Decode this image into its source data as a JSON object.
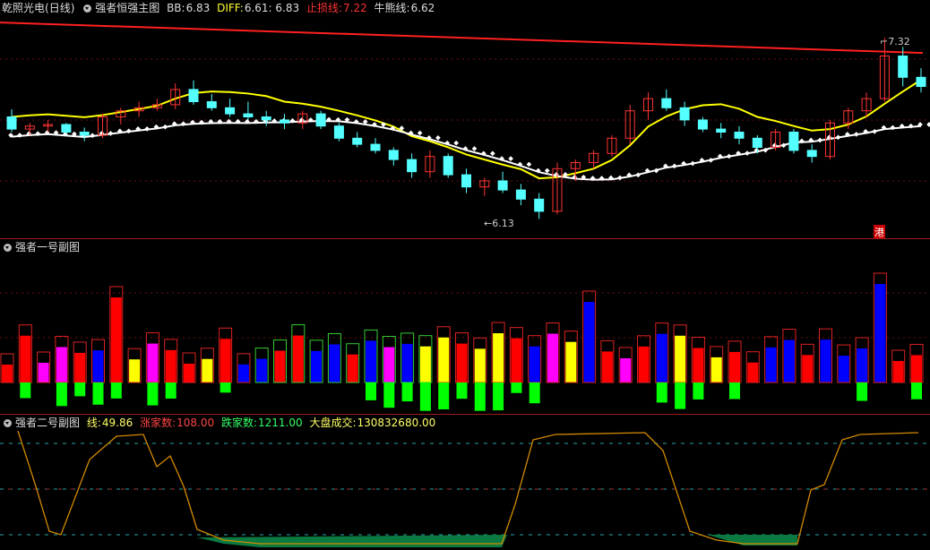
{
  "main": {
    "stock_name": "乾照光电",
    "period": "(日线)",
    "indicator_name": "强者恒强主图",
    "bb_label": "BB:",
    "bb_value": "6.83",
    "diff_label": "DIFF:",
    "diff_value": "6.61",
    "extra_value": ": 6.83",
    "stop_loss_label": "止损线:",
    "stop_loss_value": "7.22",
    "bull_label": "牛熊线:",
    "bull_value": "6.62",
    "high_mark": "7.32",
    "low_mark": "6.13",
    "hk_badge": "港"
  },
  "sub1": {
    "indicator_name": "强者一号副图"
  },
  "sub2": {
    "indicator_name": "强者二号副图",
    "line_label": "线:",
    "line_value": "49.86",
    "up_label": "涨家数:",
    "up_value": "108.00",
    "down_label": "跌家数:",
    "down_value": "1211.00",
    "volume_label": "大盘成交:",
    "volume_value": "130832680.00"
  },
  "colors": {
    "background": "#000000",
    "up_candle": "#ff3333",
    "down_candle": "#54ffff",
    "stop_loss_line": "#ff2020",
    "yellow_line": "#ffff00",
    "white_line": "#ffffff",
    "bull_line": "#ffffff",
    "bar_red": "#ff0000",
    "bar_blue": "#0000ff",
    "bar_yellow": "#ffff00",
    "bar_magenta": "#ff00ff",
    "bar_green": "#00ff00",
    "orange_line": "#d48a00",
    "label_yellow": "#ffff66",
    "label_red": "#ff4444",
    "label_green": "#33ff66"
  },
  "chart_data": [
    {
      "type": "candlestick",
      "title": "强者恒强主图",
      "ohlc_estimates": [
        [
          6.8,
          6.85,
          6.7,
          6.72
        ],
        [
          6.72,
          6.76,
          6.68,
          6.74
        ],
        [
          6.74,
          6.78,
          6.7,
          6.75
        ],
        [
          6.75,
          6.76,
          6.69,
          6.7
        ],
        [
          6.7,
          6.73,
          6.64,
          6.68
        ],
        [
          6.68,
          6.82,
          6.66,
          6.8
        ],
        [
          6.8,
          6.86,
          6.75,
          6.84
        ],
        [
          6.84,
          6.9,
          6.8,
          6.86
        ],
        [
          6.86,
          6.92,
          6.84,
          6.88
        ],
        [
          6.88,
          7.02,
          6.85,
          6.98
        ],
        [
          6.98,
          7.04,
          6.88,
          6.9
        ],
        [
          6.9,
          6.95,
          6.84,
          6.86
        ],
        [
          6.86,
          6.92,
          6.8,
          6.82
        ],
        [
          6.82,
          6.9,
          6.78,
          6.8
        ],
        [
          6.8,
          6.84,
          6.74,
          6.78
        ],
        [
          6.78,
          6.82,
          6.72,
          6.76
        ],
        [
          6.76,
          6.84,
          6.72,
          6.82
        ],
        [
          6.82,
          6.84,
          6.72,
          6.74
        ],
        [
          6.74,
          6.76,
          6.64,
          6.66
        ],
        [
          6.66,
          6.7,
          6.6,
          6.62
        ],
        [
          6.62,
          6.66,
          6.56,
          6.58
        ],
        [
          6.58,
          6.6,
          6.48,
          6.52
        ],
        [
          6.52,
          6.56,
          6.4,
          6.44
        ],
        [
          6.44,
          6.58,
          6.4,
          6.54
        ],
        [
          6.54,
          6.56,
          6.4,
          6.42
        ],
        [
          6.42,
          6.46,
          6.3,
          6.34
        ],
        [
          6.34,
          6.4,
          6.28,
          6.38
        ],
        [
          6.38,
          6.44,
          6.3,
          6.32
        ],
        [
          6.32,
          6.36,
          6.22,
          6.26
        ],
        [
          6.26,
          6.3,
          6.13,
          6.18
        ],
        [
          6.18,
          6.5,
          6.16,
          6.46
        ],
        [
          6.46,
          6.52,
          6.38,
          6.5
        ],
        [
          6.5,
          6.58,
          6.46,
          6.56
        ],
        [
          6.56,
          6.68,
          6.54,
          6.66
        ],
        [
          6.66,
          6.88,
          6.62,
          6.84
        ],
        [
          6.84,
          6.96,
          6.78,
          6.92
        ],
        [
          6.92,
          6.98,
          6.84,
          6.86
        ],
        [
          6.86,
          6.9,
          6.74,
          6.78
        ],
        [
          6.78,
          6.8,
          6.7,
          6.72
        ],
        [
          6.72,
          6.76,
          6.66,
          6.7
        ],
        [
          6.7,
          6.74,
          6.62,
          6.66
        ],
        [
          6.66,
          6.68,
          6.56,
          6.6
        ],
        [
          6.6,
          6.72,
          6.58,
          6.7
        ],
        [
          6.7,
          6.72,
          6.56,
          6.58
        ],
        [
          6.58,
          6.62,
          6.5,
          6.54
        ],
        [
          6.54,
          6.78,
          6.52,
          6.76
        ],
        [
          6.76,
          6.86,
          6.72,
          6.84
        ],
        [
          6.84,
          6.96,
          6.8,
          6.92
        ],
        [
          6.92,
          7.32,
          6.9,
          7.2
        ],
        [
          7.2,
          7.26,
          7.0,
          7.06
        ],
        [
          7.06,
          7.12,
          6.96,
          7.0
        ]
      ]
    },
    {
      "type": "bar",
      "title": "强者一号副图"
    },
    {
      "type": "line",
      "title": "强者二号副图",
      "series": [
        {
          "name": "线",
          "last_value": 49.86
        }
      ]
    }
  ]
}
